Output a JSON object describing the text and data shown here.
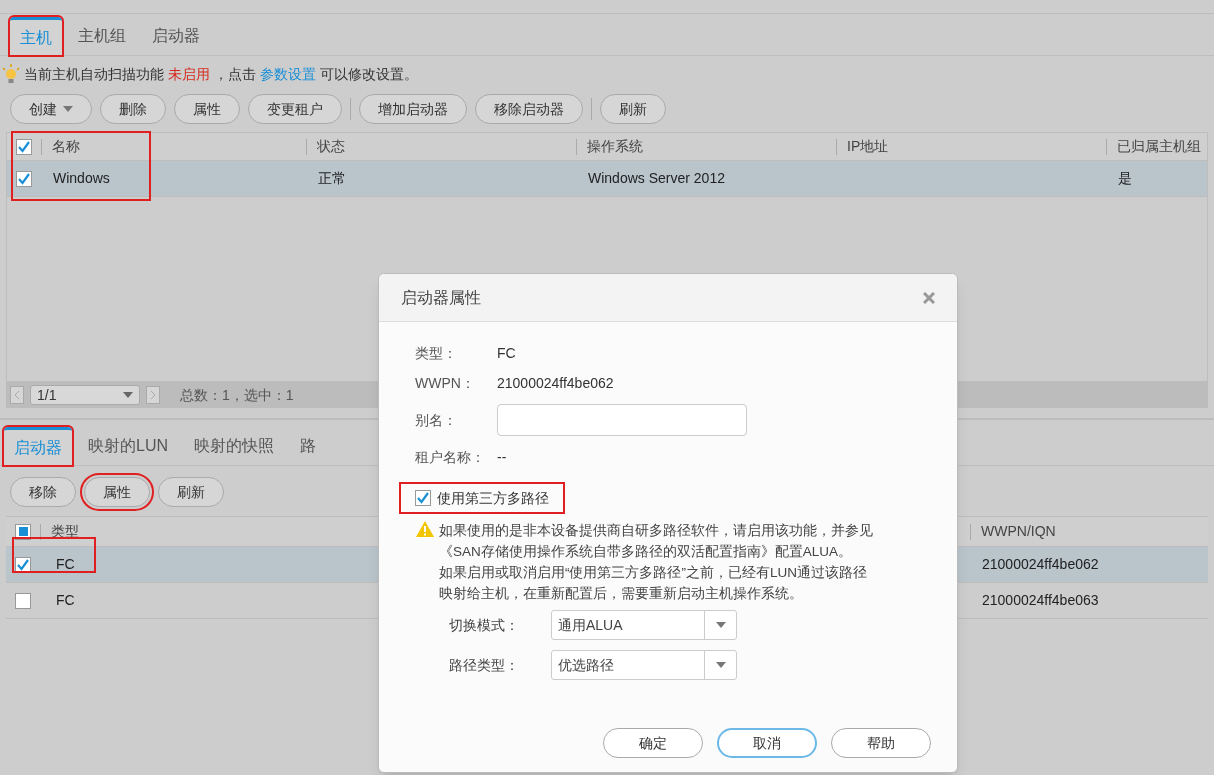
{
  "main_tabs": [
    {
      "label": "主机",
      "selected": true,
      "highlighted": true
    },
    {
      "label": "主机组",
      "selected": false,
      "highlighted": false
    },
    {
      "label": "启动器",
      "selected": false,
      "highlighted": false
    }
  ],
  "notice": {
    "before": "当前主机自动扫描功能",
    "status": "未启用",
    "middle": "，点击",
    "link": "参数设置",
    "after": "可以修改设置。"
  },
  "host_toolbar": [
    [
      {
        "label": "创建",
        "dropdown": true
      },
      {
        "label": "删除",
        "dropdown": false
      },
      {
        "label": "属性",
        "dropdown": false
      },
      {
        "label": "变更租户",
        "dropdown": false
      }
    ],
    [
      {
        "label": "增加启动器",
        "dropdown": false
      },
      {
        "label": "移除启动器",
        "dropdown": false
      }
    ],
    [
      {
        "label": "刷新",
        "dropdown": false
      }
    ]
  ],
  "host_table": {
    "header_checked": true,
    "first_column_highlighted": true,
    "columns": [
      {
        "label": "名称"
      },
      {
        "label": "状态"
      },
      {
        "label": "操作系统"
      },
      {
        "label": "IP地址"
      },
      {
        "label": "已归属主机组"
      }
    ],
    "rows": [
      {
        "checked": true,
        "selected": true,
        "cells": [
          "Windows",
          "正常",
          "Windows Server 2012",
          null,
          "是"
        ]
      }
    ]
  },
  "pager": {
    "page": "1/1",
    "summary": "总数：1，选中：1"
  },
  "detail_tabs": [
    {
      "label": "启动器",
      "selected": true,
      "highlighted": true
    },
    {
      "label": "映射的LUN",
      "selected": false,
      "highlighted": false
    },
    {
      "label": "映射的快照",
      "selected": false,
      "highlighted": false
    },
    {
      "label": "路",
      "selected": false,
      "highlighted": false
    }
  ],
  "initiator_toolbar": [
    {
      "label": "移除",
      "highlighted": false
    },
    {
      "label": "属性",
      "highlighted": true
    },
    {
      "label": "刷新",
      "highlighted": false
    }
  ],
  "initiator_table": {
    "header_indeterminate": true,
    "columns": [
      {
        "label": "类型"
      },
      {
        "label": "WWPN/IQN"
      }
    ],
    "rows": [
      {
        "checked": true,
        "selected": true,
        "highlighted": true,
        "cells": [
          "FC",
          "21000024ff4be062"
        ]
      },
      {
        "checked": false,
        "selected": false,
        "highlighted": false,
        "cells": [
          "FC",
          "21000024ff4be063"
        ]
      }
    ]
  },
  "dialog": {
    "title": "启动器属性",
    "fields": [
      {
        "kind": "text",
        "label": "类型：",
        "value": "FC"
      },
      {
        "kind": "text",
        "label": "WWPN：",
        "value": "21000024ff4be062"
      },
      {
        "kind": "input",
        "label": "别名："
      },
      {
        "kind": "text",
        "label": "租户名称：",
        "value": "--"
      }
    ],
    "multipath": {
      "label": "使用第三方多路径",
      "checked": true,
      "highlighted": true
    },
    "warning": [
      "如果使用的是非本设备提供商自研多路径软件，请启用该功能，并参见",
      "《SAN存储使用操作系统自带多路径的双活配置指南》配置ALUA。",
      "如果启用或取消启用“使用第三方多路径”之前，已经有LUN通过该路径",
      "映射给主机，在重新配置后，需要重新启动主机操作系统。"
    ],
    "selects": [
      {
        "label": "切换模式：",
        "value": "通用ALUA"
      },
      {
        "label": "路径类型：",
        "value": "优选路径"
      }
    ],
    "buttons": [
      {
        "label": "确定",
        "focused": false
      },
      {
        "label": "取消",
        "focused": true
      },
      {
        "label": "帮助",
        "focused": false
      }
    ]
  }
}
